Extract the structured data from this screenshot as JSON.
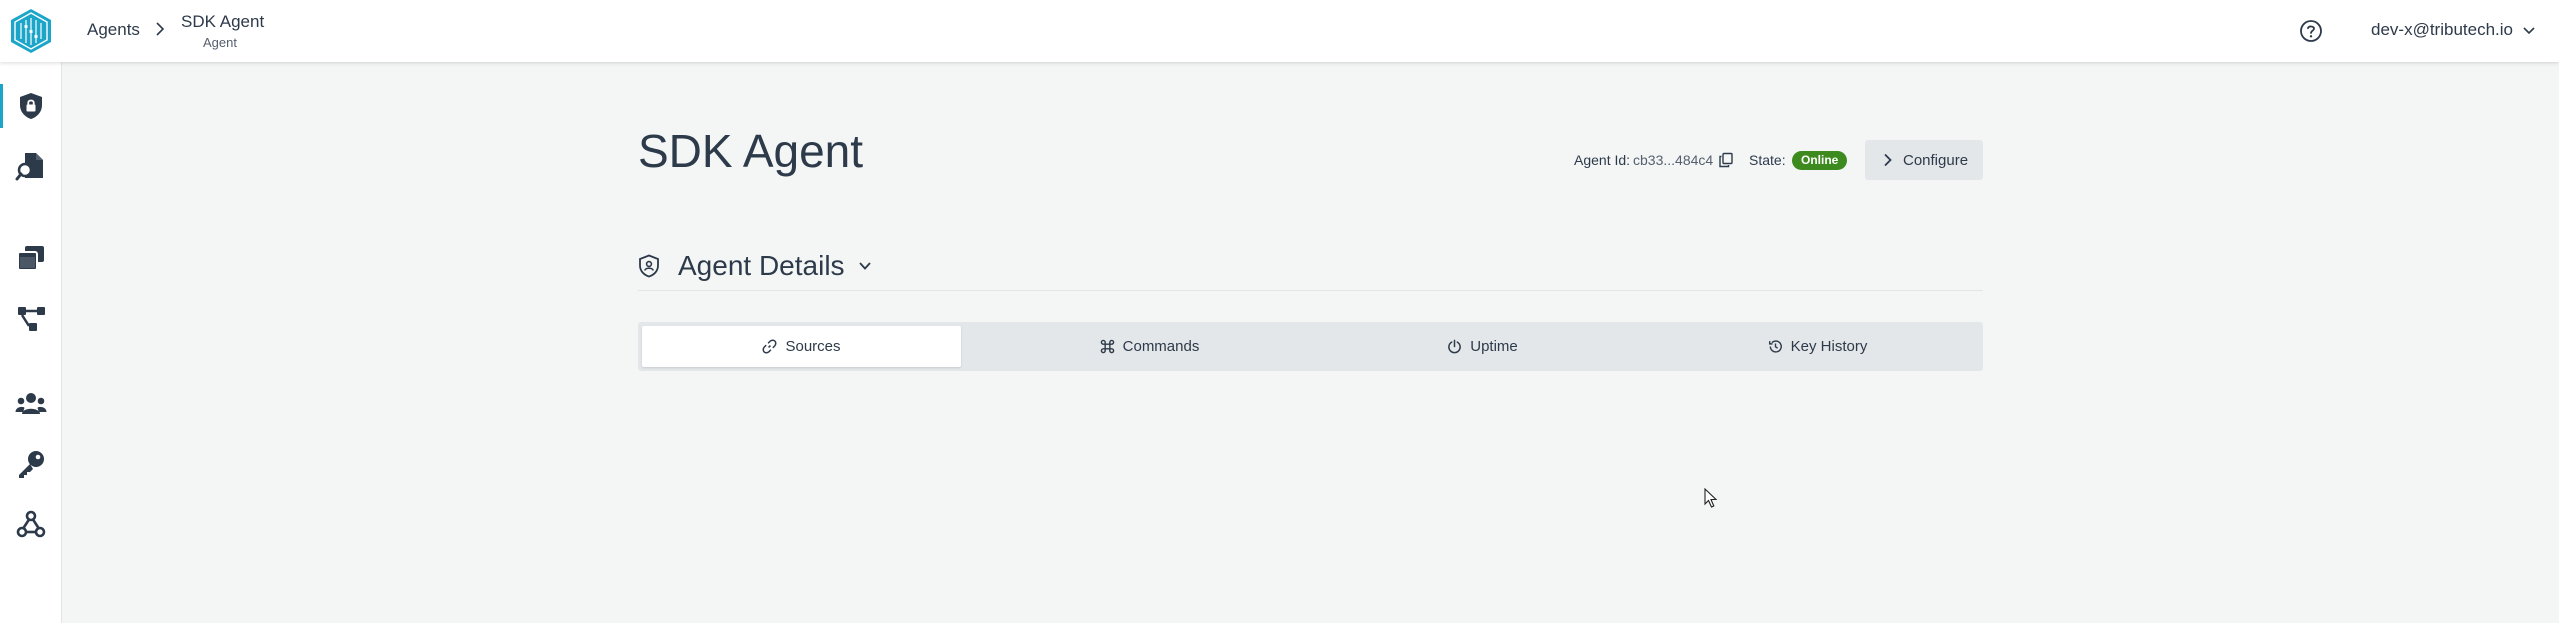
{
  "header": {
    "breadcrumb_root": "Agents",
    "page_title": "SDK Agent",
    "page_subtitle": "Agent",
    "user": "dev-x@tributech.io"
  },
  "sidebar": {
    "items": [
      {
        "icon": "shield-lock-icon",
        "active": true
      },
      {
        "icon": "file-search-icon",
        "active": false
      },
      {
        "icon": "stacked-windows-icon",
        "active": false
      },
      {
        "icon": "network-icon",
        "active": false
      },
      {
        "icon": "users-icon",
        "active": false
      },
      {
        "icon": "key-icon",
        "active": false
      },
      {
        "icon": "webhook-icon",
        "active": false
      }
    ]
  },
  "main": {
    "title": "SDK Agent",
    "agent_id_label": "Agent Id:",
    "agent_id_value": "cb33...484c4",
    "state_label": "State:",
    "state_value": "Online",
    "configure_label": "Configure",
    "details_title": "Agent Details",
    "tabs": [
      {
        "label": "Sources",
        "icon": "link-icon",
        "active": true
      },
      {
        "label": "Commands",
        "icon": "command-icon",
        "active": false
      },
      {
        "label": "Uptime",
        "icon": "power-icon",
        "active": false
      },
      {
        "label": "Key History",
        "icon": "history-icon",
        "active": false
      }
    ]
  },
  "colors": {
    "accent": "#1ba6c9",
    "online_badge": "#3d8a1f",
    "text": "#2d3a4a",
    "background": "#f4f6f6"
  }
}
